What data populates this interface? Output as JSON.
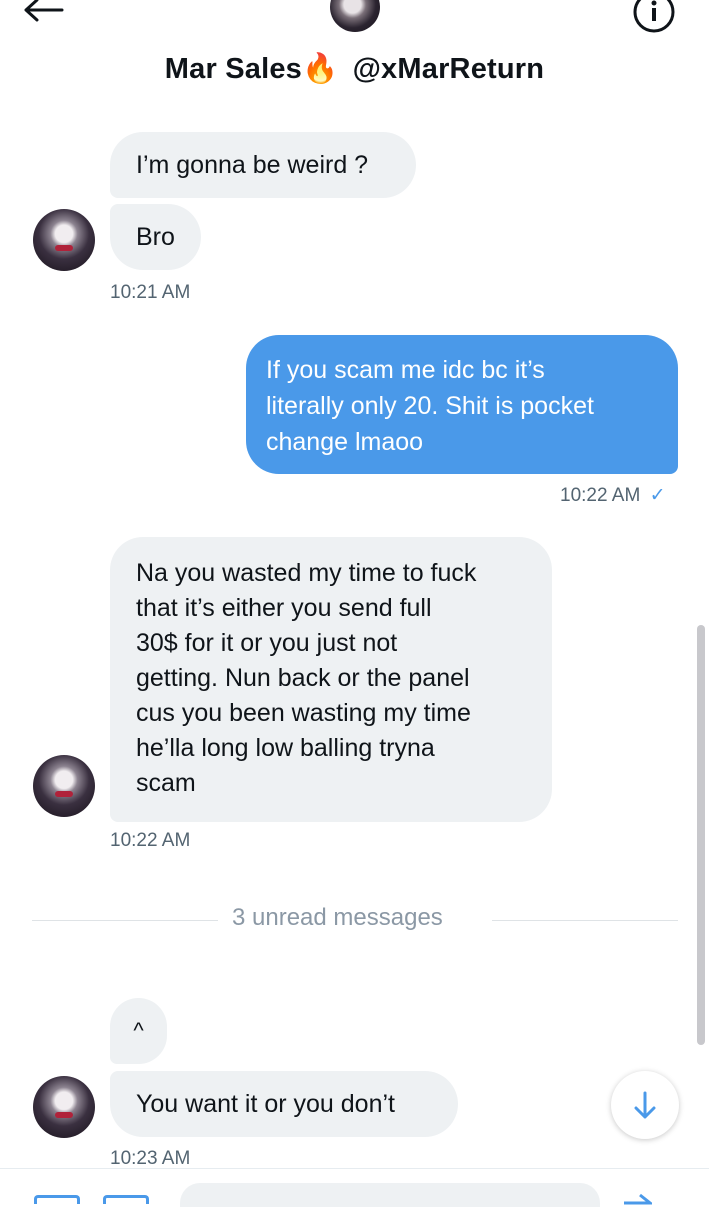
{
  "header": {
    "contact_name": "Mar Sales",
    "name_emoji": "🔥",
    "handle": "@xMarReturn",
    "icons": [
      "back-arrow-icon",
      "info-icon"
    ]
  },
  "messages": [
    {
      "dir": "in",
      "text": "I’m gonna be weird ?"
    },
    {
      "dir": "in",
      "text": "Bro",
      "time": "10:21 AM"
    },
    {
      "dir": "out",
      "lines": [
        "If you scam me idc bc it’s",
        "literally only 20. Shit is pocket",
        "change lmaoo"
      ],
      "time": "10:22 AM",
      "status": "✓"
    },
    {
      "dir": "in",
      "lines": [
        "Na you wasted my time to fuck",
        "that it’s either you send full",
        "30$ for it or you just not",
        "getting. Nun back or the panel",
        "cus you been wasting my time",
        "he’lla long low balling tryna",
        "scam"
      ],
      "time": "10:22 AM"
    },
    {
      "dir": "in",
      "text": "^"
    },
    {
      "dir": "in",
      "text": "You want it or you don’t",
      "time": "10:23 AM"
    }
  ],
  "unread_divider": "3 unread messages",
  "colors": {
    "accent": "#4a99e9",
    "incoming_bubble": "#eef1f3",
    "muted_text": "#536471"
  }
}
